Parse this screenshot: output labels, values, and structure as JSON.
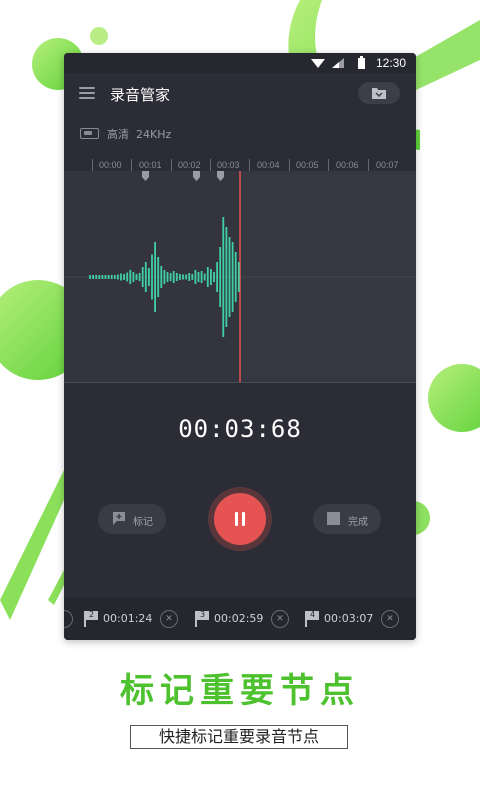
{
  "status_bar": {
    "time": "12:30"
  },
  "app_bar": {
    "title": "录音管家",
    "folder_icon": "folder-icon"
  },
  "quality": {
    "label": "高清",
    "sample_rate": "24KHz"
  },
  "timeline": {
    "labels": [
      "00:00",
      "00:01",
      "00:02",
      "00:03",
      "00:04",
      "00:05",
      "00:06",
      "00:07"
    ]
  },
  "timer": {
    "value": "00:03:68"
  },
  "controls": {
    "mark_label": "标记",
    "done_label": "完成"
  },
  "marks": [
    {
      "index": "2",
      "time": "00:01:24"
    },
    {
      "index": "3",
      "time": "00:02:59"
    },
    {
      "index": "4",
      "time": "00:03:07"
    }
  ],
  "promo": {
    "headline": "标记重要节点",
    "subtitle": "快捷标记重要录音节点"
  },
  "colors": {
    "accent_green": "#4dc22e",
    "wave": "#3fd0a4",
    "record_red": "#e55353",
    "panel": "#2b2c35"
  }
}
